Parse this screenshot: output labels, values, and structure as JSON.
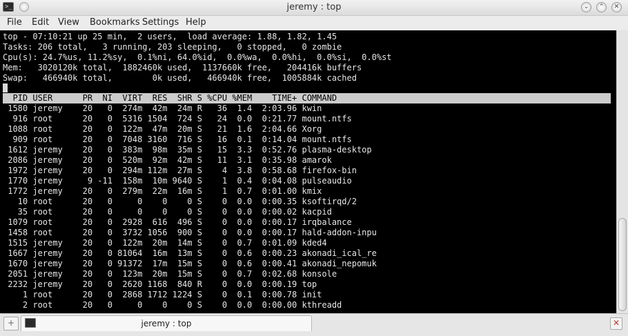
{
  "window": {
    "title": "jeremy : top",
    "pin_symbol": "•",
    "minimize_symbol": "⌄",
    "maximize_symbol": "⌃",
    "close_symbol": "✕"
  },
  "menu": [
    "File",
    "Edit",
    "View",
    "Bookmarks",
    "Settings",
    "Help"
  ],
  "terminal": {
    "summary_lines": [
      "top - 07:10:21 up 25 min,  2 users,  load average: 1.88, 1.82, 1.45",
      "Tasks: 206 total,   3 running, 203 sleeping,   0 stopped,   0 zombie",
      "Cpu(s): 24.7%us, 11.2%sy,  0.1%ni, 64.0%id,  0.0%wa,  0.0%hi,  0.0%si,  0.0%st",
      "Mem:   3020120k total,  1882460k used,  1137660k free,   204416k buffers",
      "Swap:   466940k total,        0k used,   466940k free,  1005884k cached"
    ],
    "columns": [
      "PID",
      "USER",
      "PR",
      "NI",
      "VIRT",
      "RES",
      "SHR",
      "S",
      "%CPU",
      "%MEM",
      "TIME+",
      "COMMAND"
    ],
    "processes": [
      [
        "1580",
        "jeremy",
        "20",
        "0",
        "274m",
        "42m",
        "24m",
        "R",
        "36",
        "1.4",
        "2:03.96",
        "kwin"
      ],
      [
        "916",
        "root",
        "20",
        "0",
        "5316",
        "1504",
        "724",
        "S",
        "24",
        "0.0",
        "0:21.77",
        "mount.ntfs"
      ],
      [
        "1088",
        "root",
        "20",
        "0",
        "122m",
        "47m",
        "20m",
        "S",
        "21",
        "1.6",
        "2:04.66",
        "Xorg"
      ],
      [
        "909",
        "root",
        "20",
        "0",
        "7048",
        "3160",
        "716",
        "S",
        "16",
        "0.1",
        "0:14.04",
        "mount.ntfs"
      ],
      [
        "1612",
        "jeremy",
        "20",
        "0",
        "383m",
        "98m",
        "35m",
        "S",
        "15",
        "3.3",
        "0:52.76",
        "plasma-desktop"
      ],
      [
        "2086",
        "jeremy",
        "20",
        "0",
        "520m",
        "92m",
        "42m",
        "S",
        "11",
        "3.1",
        "0:35.98",
        "amarok"
      ],
      [
        "1972",
        "jeremy",
        "20",
        "0",
        "294m",
        "112m",
        "27m",
        "S",
        "4",
        "3.8",
        "0:58.68",
        "firefox-bin"
      ],
      [
        "1770",
        "jeremy",
        "9",
        "-11",
        "158m",
        "10m",
        "9640",
        "S",
        "1",
        "0.4",
        "0:04.08",
        "pulseaudio"
      ],
      [
        "1772",
        "jeremy",
        "20",
        "0",
        "279m",
        "22m",
        "16m",
        "S",
        "1",
        "0.7",
        "0:01.00",
        "kmix"
      ],
      [
        "10",
        "root",
        "20",
        "0",
        "0",
        "0",
        "0",
        "S",
        "0",
        "0.0",
        "0:00.35",
        "ksoftirqd/2"
      ],
      [
        "35",
        "root",
        "20",
        "0",
        "0",
        "0",
        "0",
        "S",
        "0",
        "0.0",
        "0:00.02",
        "kacpid"
      ],
      [
        "1079",
        "root",
        "20",
        "0",
        "2928",
        "616",
        "496",
        "S",
        "0",
        "0.0",
        "0:00.17",
        "irqbalance"
      ],
      [
        "1458",
        "root",
        "20",
        "0",
        "3732",
        "1056",
        "900",
        "S",
        "0",
        "0.0",
        "0:00.17",
        "hald-addon-inpu"
      ],
      [
        "1515",
        "jeremy",
        "20",
        "0",
        "122m",
        "20m",
        "14m",
        "S",
        "0",
        "0.7",
        "0:01.09",
        "kded4"
      ],
      [
        "1667",
        "jeremy",
        "20",
        "0",
        "81064",
        "16m",
        "13m",
        "S",
        "0",
        "0.6",
        "0:00.23",
        "akonadi_ical_re"
      ],
      [
        "1670",
        "jeremy",
        "20",
        "0",
        "91372",
        "17m",
        "15m",
        "S",
        "0",
        "0.6",
        "0:00.41",
        "akonadi_nepomuk"
      ],
      [
        "2051",
        "jeremy",
        "20",
        "0",
        "123m",
        "20m",
        "15m",
        "S",
        "0",
        "0.7",
        "0:02.68",
        "konsole"
      ],
      [
        "2232",
        "jeremy",
        "20",
        "0",
        "2620",
        "1168",
        "840",
        "R",
        "0",
        "0.0",
        "0:00.19",
        "top"
      ],
      [
        "1",
        "root",
        "20",
        "0",
        "2868",
        "1712",
        "1224",
        "S",
        "0",
        "0.1",
        "0:00.78",
        "init"
      ],
      [
        "2",
        "root",
        "20",
        "0",
        "0",
        "0",
        "0",
        "S",
        "0",
        "0.0",
        "0:00.00",
        "kthreadd"
      ]
    ]
  },
  "tabbar": {
    "tab_label": "jeremy : top",
    "new_tab_symbol": "+",
    "close_symbol": "✕"
  },
  "colors": {
    "terminal_bg": "#000000",
    "terminal_fg": "#e5e5e5",
    "header_row_bg": "#cccccc"
  }
}
